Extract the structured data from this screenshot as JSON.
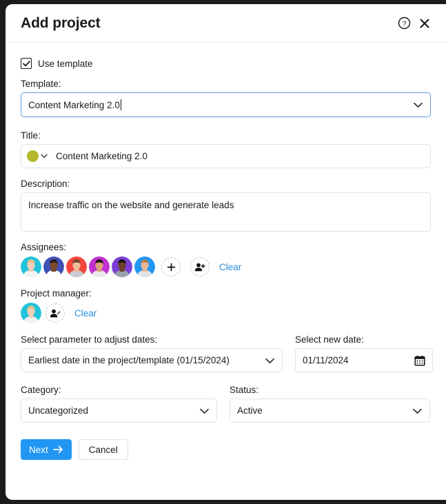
{
  "dialog": {
    "title": "Add project",
    "help_icon": "help-circle-icon",
    "close_icon": "close-icon"
  },
  "use_template": {
    "label": "Use template",
    "checked": true
  },
  "template": {
    "label": "Template:",
    "value": "Content Marketing 2.0",
    "focused": true
  },
  "title": {
    "label": "Title:",
    "value": "Content Marketing 2.0",
    "color": "#b5b82e"
  },
  "description": {
    "label": "Description:",
    "value": "Increase traffic on the website and generate leads"
  },
  "assignees": {
    "label": "Assignees:",
    "avatars": [
      {
        "name": "assignee-avatar-1",
        "bg": "#22c3dd",
        "skin": "#f2cfb6",
        "hair": "#e2c08a",
        "shirt": "#f3f3f3"
      },
      {
        "name": "assignee-avatar-2",
        "bg": "#3f51b5",
        "skin": "#7b4a2d",
        "hair": "#2a1a10",
        "shirt": "#ffffff"
      },
      {
        "name": "assignee-avatar-3",
        "bg": "#f4463c",
        "skin": "#edbb9a",
        "hair": "#6b4a32",
        "shirt": "#c9ccd1"
      },
      {
        "name": "assignee-avatar-4",
        "bg": "#c030d0",
        "skin": "#d8a177",
        "hair": "#1d1208",
        "shirt": "#e9e9ec"
      },
      {
        "name": "assignee-avatar-5",
        "bg": "#7b3fd4",
        "skin": "#6a4128",
        "hair": "#1a1208",
        "shirt": "#9aa3ad"
      },
      {
        "name": "assignee-avatar-6",
        "bg": "#2196f3",
        "skin": "#e8b895",
        "hair": "#b08050",
        "shirt": "#dfe3e8"
      }
    ],
    "add_label": "+",
    "add_icon": "person-add-icon",
    "clear_label": "Clear"
  },
  "project_manager": {
    "label": "Project manager:",
    "avatar": {
      "name": "project-manager-avatar",
      "bg": "#22c3dd",
      "skin": "#f2cfb6",
      "hair": "#e2c08a",
      "shirt": "#f3f3f3"
    },
    "edit_icon": "person-edit-icon",
    "clear_label": "Clear"
  },
  "adjust_dates": {
    "label": "Select parameter to adjust dates:",
    "value": "Earliest date in the project/template (01/15/2024)"
  },
  "new_date": {
    "label": "Select new date:",
    "value": "01/11/2024",
    "calendar_icon": "calendar-icon"
  },
  "category": {
    "label": "Category:",
    "value": "Uncategorized"
  },
  "status": {
    "label": "Status:",
    "value": "Active"
  },
  "footer": {
    "next_label": "Next",
    "next_arrow_icon": "arrow-right-icon",
    "cancel_label": "Cancel",
    "accent_color": "#2196f3"
  }
}
